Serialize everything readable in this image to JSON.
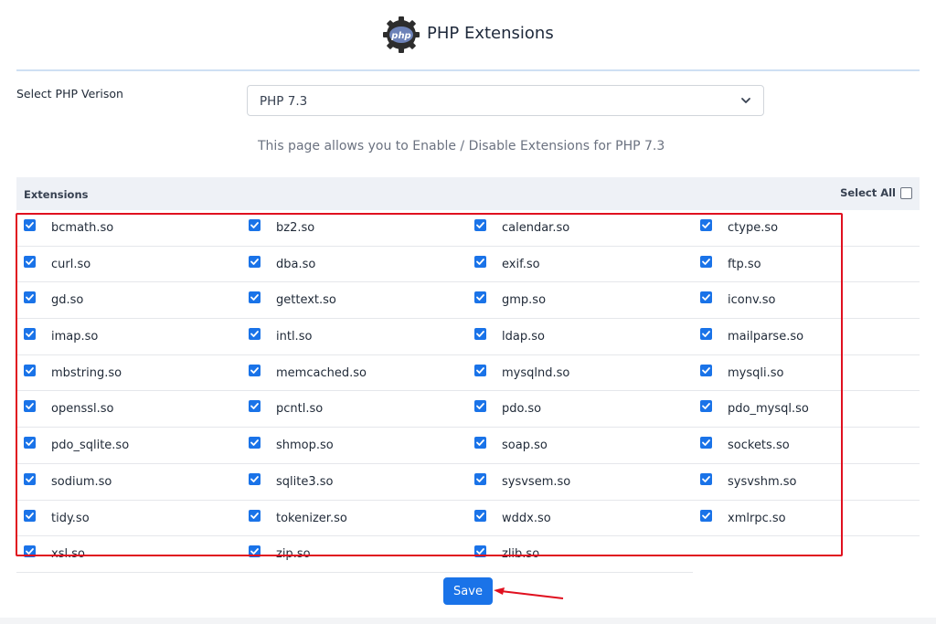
{
  "header": {
    "title": "PHP Extensions",
    "logo_icon": "php-gear-icon"
  },
  "version": {
    "label": "Select PHP Verison",
    "selected": "PHP 7.3"
  },
  "info_text": "This page allows you to Enable / Disable Extensions for PHP 7.3",
  "extensions_header": {
    "label": "Extensions",
    "select_all": "Select All",
    "select_all_checked": false
  },
  "extensions": [
    [
      "bcmath.so",
      "bz2.so",
      "calendar.so",
      "ctype.so"
    ],
    [
      "curl.so",
      "dba.so",
      "exif.so",
      "ftp.so"
    ],
    [
      "gd.so",
      "gettext.so",
      "gmp.so",
      "iconv.so"
    ],
    [
      "imap.so",
      "intl.so",
      "ldap.so",
      "mailparse.so"
    ],
    [
      "mbstring.so",
      "memcached.so",
      "mysqlnd.so",
      "mysqli.so"
    ],
    [
      "openssl.so",
      "pcntl.so",
      "pdo.so",
      "pdo_mysql.so"
    ],
    [
      "pdo_sqlite.so",
      "shmop.so",
      "soap.so",
      "sockets.so"
    ],
    [
      "sodium.so",
      "sqlite3.so",
      "sysvsem.so",
      "sysvshm.so"
    ],
    [
      "tidy.so",
      "tokenizer.so",
      "wddx.so",
      "xmlrpc.so"
    ],
    [
      "xsl.so",
      "zip.so",
      "zlib.so"
    ]
  ],
  "save_label": "Save",
  "colors": {
    "accent": "#1a73e8",
    "highlight": "#e0101f"
  }
}
